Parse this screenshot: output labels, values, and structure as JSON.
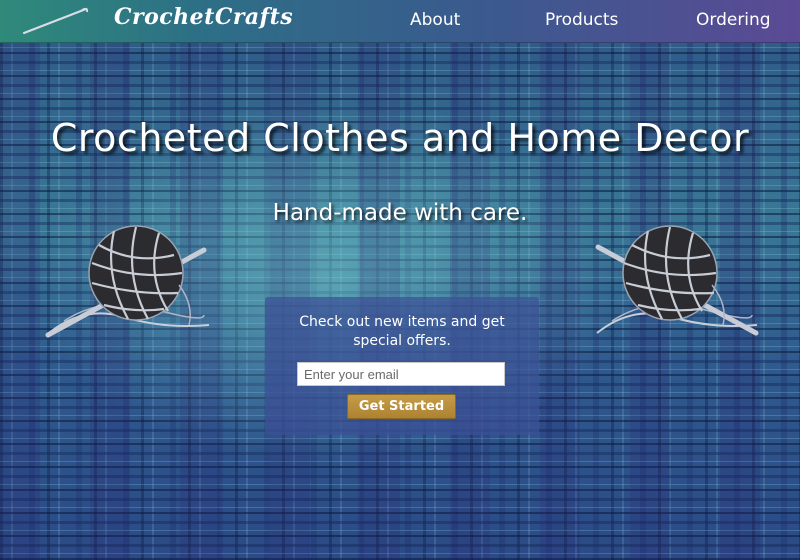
{
  "nav": {
    "brand": "CrochetCrafts",
    "links": [
      "About",
      "Products",
      "Ordering"
    ]
  },
  "hero": {
    "headline": "Crocheted Clothes and Home Decor",
    "subhead": "Hand-made with care."
  },
  "signup": {
    "message": "Check out new items and get special offers.",
    "email_placeholder": "Enter your email",
    "button_label": "Get Started"
  },
  "colors": {
    "button": "#b88a3a",
    "nav_gradient_start": "#2f8a7a",
    "nav_gradient_end": "#5b4a95"
  },
  "icons": [
    "crochet-hook-icon",
    "yarn-ball-icon"
  ]
}
